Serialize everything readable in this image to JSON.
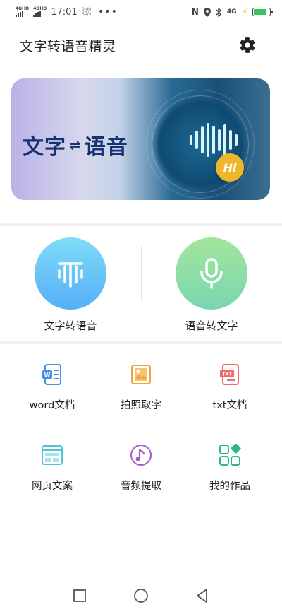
{
  "status_bar": {
    "network1": "4GHD",
    "network2": "4GHD",
    "time": "17:01",
    "speed_value": "0.00",
    "speed_unit": "KB/s",
    "more": "•••",
    "network_right": "4G",
    "battery_color": "#39c35f"
  },
  "header": {
    "title": "文字转语音精灵",
    "settings_icon": "gear-icon"
  },
  "banner": {
    "left_text": "文字",
    "arrows": "⇌",
    "right_text": "语音",
    "badge": "Hi"
  },
  "features": [
    {
      "label": "文字转语音",
      "icon": "sound-wave-icon",
      "color": "#66c6f8"
    },
    {
      "label": "语音转文字",
      "icon": "microphone-icon",
      "color": "#8fdc9e"
    }
  ],
  "tools": [
    {
      "label": "word文档",
      "icon": "word-doc-icon",
      "color": "#4a90e2"
    },
    {
      "label": "拍照取字",
      "icon": "photo-icon",
      "color": "#f2a33a"
    },
    {
      "label": "txt文档",
      "icon": "txt-doc-icon",
      "color": "#ef6b6b"
    },
    {
      "label": "网页文案",
      "icon": "webpage-icon",
      "color": "#4fc3d9"
    },
    {
      "label": "音频提取",
      "icon": "music-note-icon",
      "color": "#a05cc8"
    },
    {
      "label": "我的作品",
      "icon": "apps-grid-icon",
      "color": "#2fb58a"
    }
  ],
  "nav": {
    "recent": "square-icon",
    "home": "circle-icon",
    "back": "triangle-back-icon"
  }
}
